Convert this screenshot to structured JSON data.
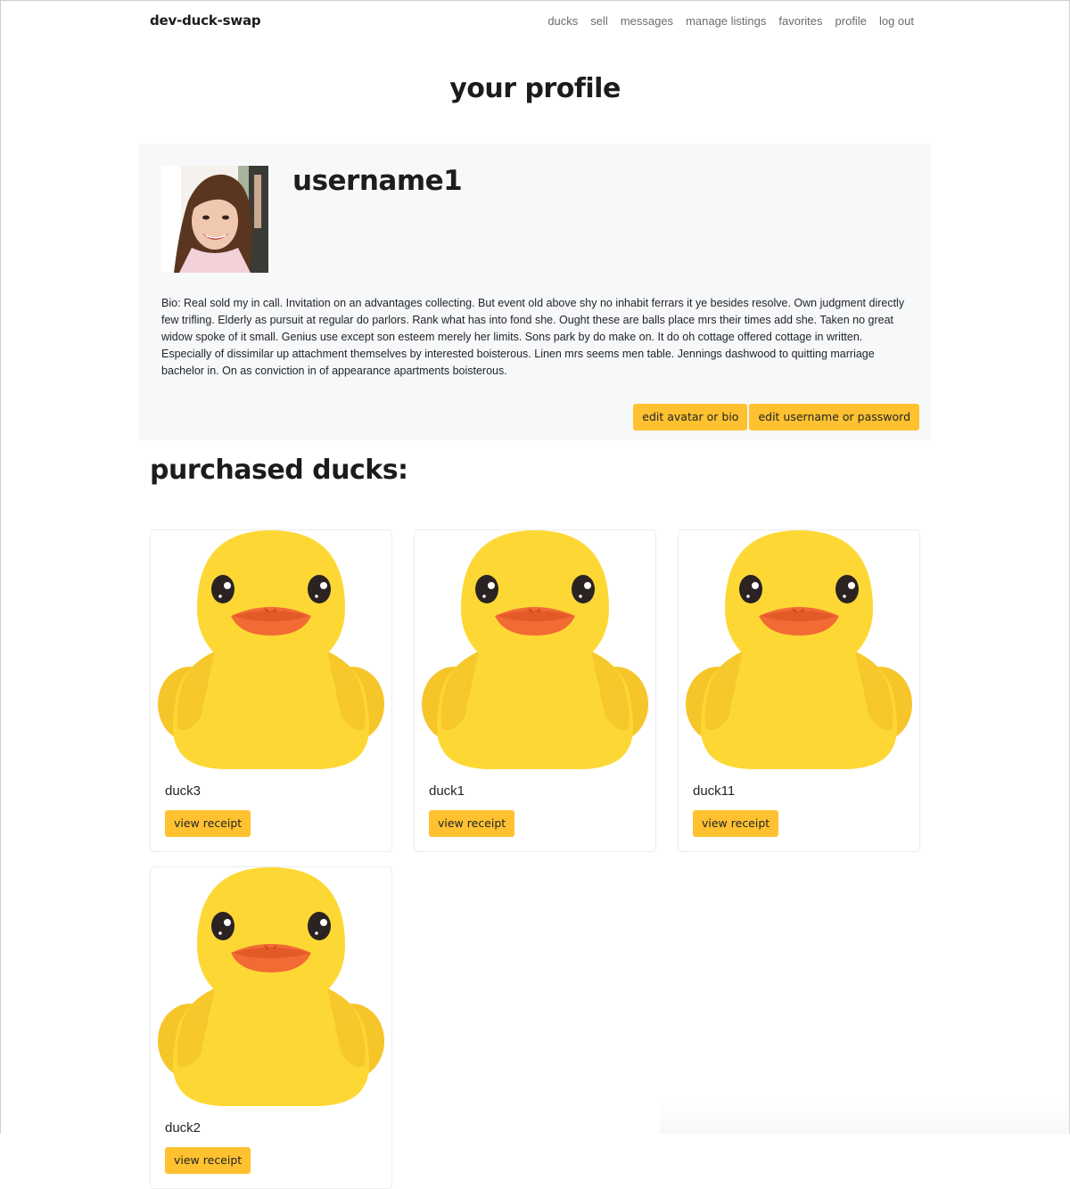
{
  "nav": {
    "brand": "dev-duck-swap",
    "links": [
      "ducks",
      "sell",
      "messages",
      "manage listings",
      "favorites",
      "profile",
      "log out"
    ]
  },
  "page": {
    "title": "your profile"
  },
  "profile": {
    "username": "username1",
    "bio": "Bio: Real sold my in call. Invitation on an advantages collecting. But event old above shy no inhabit ferrars it ye besides resolve. Own judgment directly few trifling. Elderly as pursuit at regular do parlors. Rank what has into fond she. Ought these are balls place mrs their times add she. Taken no great widow spoke of it small. Genius use except son esteem merely her limits. Sons park by do make on. It do oh cottage offered cottage in written. Especially of dissimilar up attachment themselves by interested boisterous. Linen mrs seems men table. Jennings dashwood to quitting marriage bachelor in. On as conviction in of appearance apartments boisterous.",
    "edit_avatar_label": "edit avatar or bio",
    "edit_account_label": "edit username or password"
  },
  "purchased": {
    "title": "purchased ducks:",
    "items": [
      {
        "name": "duck3",
        "button": "view receipt"
      },
      {
        "name": "duck1",
        "button": "view receipt"
      },
      {
        "name": "duck11",
        "button": "view receipt"
      },
      {
        "name": "duck2",
        "button": "view receipt"
      }
    ]
  },
  "colors": {
    "accent_button": "#ffc12f",
    "profile_bg": "#f7f8f9",
    "duck_yellow": "#fdd835",
    "duck_beak": "#f26a34"
  },
  "icons": {
    "duck": "rubber-duck-image",
    "avatar": "user-avatar-photo"
  }
}
